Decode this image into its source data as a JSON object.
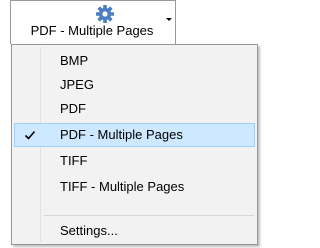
{
  "split_button": {
    "icon": "gear-icon",
    "label": "PDF - Multiple Pages"
  },
  "menu": {
    "items": [
      {
        "label": "BMP",
        "checked": false
      },
      {
        "label": "JPEG",
        "checked": false
      },
      {
        "label": "PDF",
        "checked": false
      },
      {
        "label": "PDF - Multiple Pages",
        "checked": true
      },
      {
        "label": "TIFF",
        "checked": false
      },
      {
        "label": "TIFF - Multiple Pages",
        "checked": false
      }
    ],
    "settings_label": "Settings..."
  },
  "colors": {
    "selected_bg": "#cde8ff",
    "selected_border": "#99d1ff",
    "menu_bg": "#f2f2f2",
    "gear": "#4a7fc1"
  }
}
